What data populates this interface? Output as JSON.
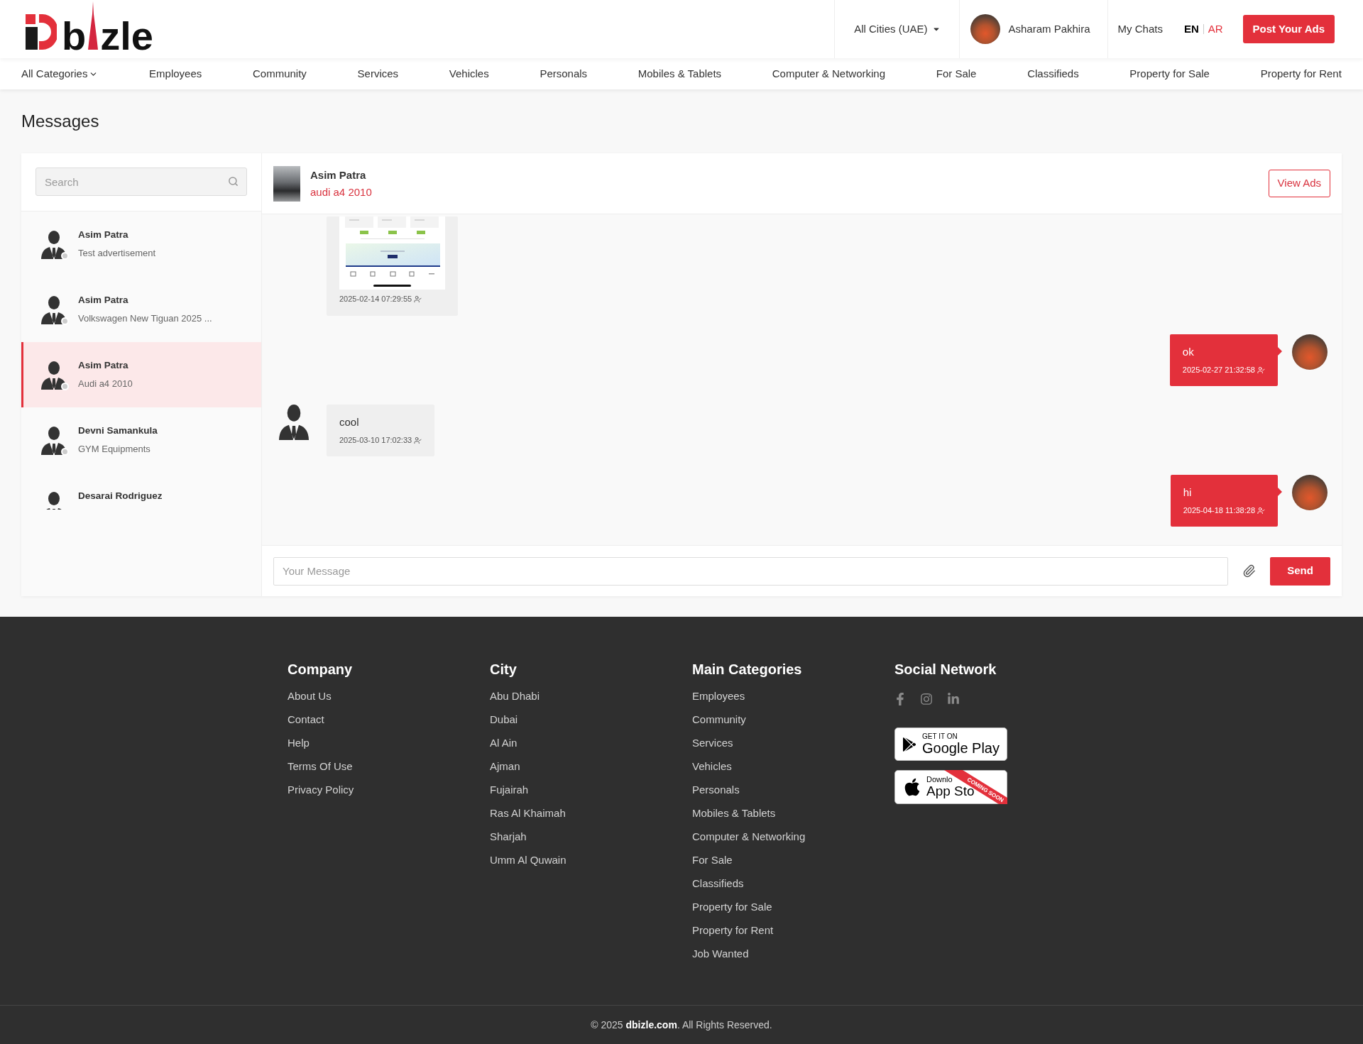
{
  "header": {
    "logo": {
      "letters_before": "b",
      "letters_after": "zle"
    },
    "city_selector": "All Cities (UAE)",
    "user": {
      "name": "Asharam Pakhira"
    },
    "my_chats": "My Chats",
    "languages": [
      {
        "label": "EN",
        "selected": true
      },
      {
        "label": "AR",
        "selected": false
      }
    ],
    "post_button": "Post Your Ads"
  },
  "nav": {
    "items": [
      {
        "label": "All Categories",
        "kind": "dropdown"
      },
      {
        "label": "Employees",
        "kind": "link"
      },
      {
        "label": "Community",
        "kind": "link"
      },
      {
        "label": "Services",
        "kind": "link"
      },
      {
        "label": "Vehicles",
        "kind": "link"
      },
      {
        "label": "Personals",
        "kind": "link"
      },
      {
        "label": "Mobiles & Tablets",
        "kind": "link"
      },
      {
        "label": "Computer & Networking",
        "kind": "link"
      },
      {
        "label": "For Sale",
        "kind": "link"
      },
      {
        "label": "Classifieds",
        "kind": "link"
      },
      {
        "label": "Property for Sale",
        "kind": "link"
      },
      {
        "label": "Property for Rent",
        "kind": "link"
      }
    ]
  },
  "page_title": "Messages",
  "search": {
    "placeholder": "Search"
  },
  "conversations": [
    {
      "name": "Asim Patra",
      "subtitle": "Test advertisement",
      "selected": false,
      "online": false
    },
    {
      "name": "Asim Patra",
      "subtitle": "Volkswagen New Tiguan 2025 ...",
      "selected": false,
      "online": false
    },
    {
      "name": "Asim Patra",
      "subtitle": "Audi a4 2010",
      "selected": true,
      "online": false
    },
    {
      "name": "Devni Samankula",
      "subtitle": "GYM Equipments",
      "selected": false,
      "online": false
    },
    {
      "name": "Desarai Rodriguez",
      "selected": false
    }
  ],
  "chat": {
    "header": {
      "name": "Asim Patra",
      "ad_title": "audi a4 2010",
      "view_button": "View Ads"
    },
    "messages": [
      {
        "kind": "image",
        "outgoing": false,
        "avatar": false,
        "time": "2025-02-14 07:29:55"
      },
      {
        "kind": "text",
        "outgoing": true,
        "avatar": true,
        "text": "ok",
        "time": "2025-02-27 21:32:58"
      },
      {
        "kind": "text",
        "outgoing": false,
        "avatar": true,
        "text": "cool",
        "time": "2025-03-10 17:02:33"
      },
      {
        "kind": "text",
        "outgoing": true,
        "avatar": true,
        "text": "hi",
        "time": "2025-04-18 11:38:28"
      }
    ],
    "composer": {
      "placeholder": "Your Message",
      "send_button": "Send"
    }
  },
  "footer": {
    "columns": [
      {
        "kind": "links",
        "title": "Company",
        "links": [
          "About Us",
          "Contact",
          "Help",
          "Terms Of Use",
          "Privacy Policy"
        ]
      },
      {
        "kind": "links",
        "title": "City",
        "links": [
          "Abu Dhabi",
          "Dubai",
          "Al Ain",
          "Ajman",
          "Fujairah",
          "Ras Al Khaimah",
          "Sharjah",
          "Umm Al Quwain"
        ]
      },
      {
        "kind": "links",
        "title": "Main Categories",
        "links": [
          "Employees",
          "Community",
          "Services",
          "Vehicles",
          "Personals",
          "Mobiles & Tablets",
          "Computer & Networking",
          "For Sale",
          "Classifieds",
          "Property for Sale",
          "Property for Rent",
          "Job Wanted"
        ]
      },
      {
        "kind": "social",
        "title": "Social Network",
        "badges": [
          {
            "kind": "google_play",
            "small_text": "GET IT ON",
            "large_text": "Google Play"
          },
          {
            "kind": "app_store",
            "small_text": "Downlo",
            "large_text": "App Sto",
            "ribbon": "COMING SOON"
          }
        ]
      }
    ],
    "copyright": "© 2025 **dbizle.com**. All Rights Reserved."
  }
}
